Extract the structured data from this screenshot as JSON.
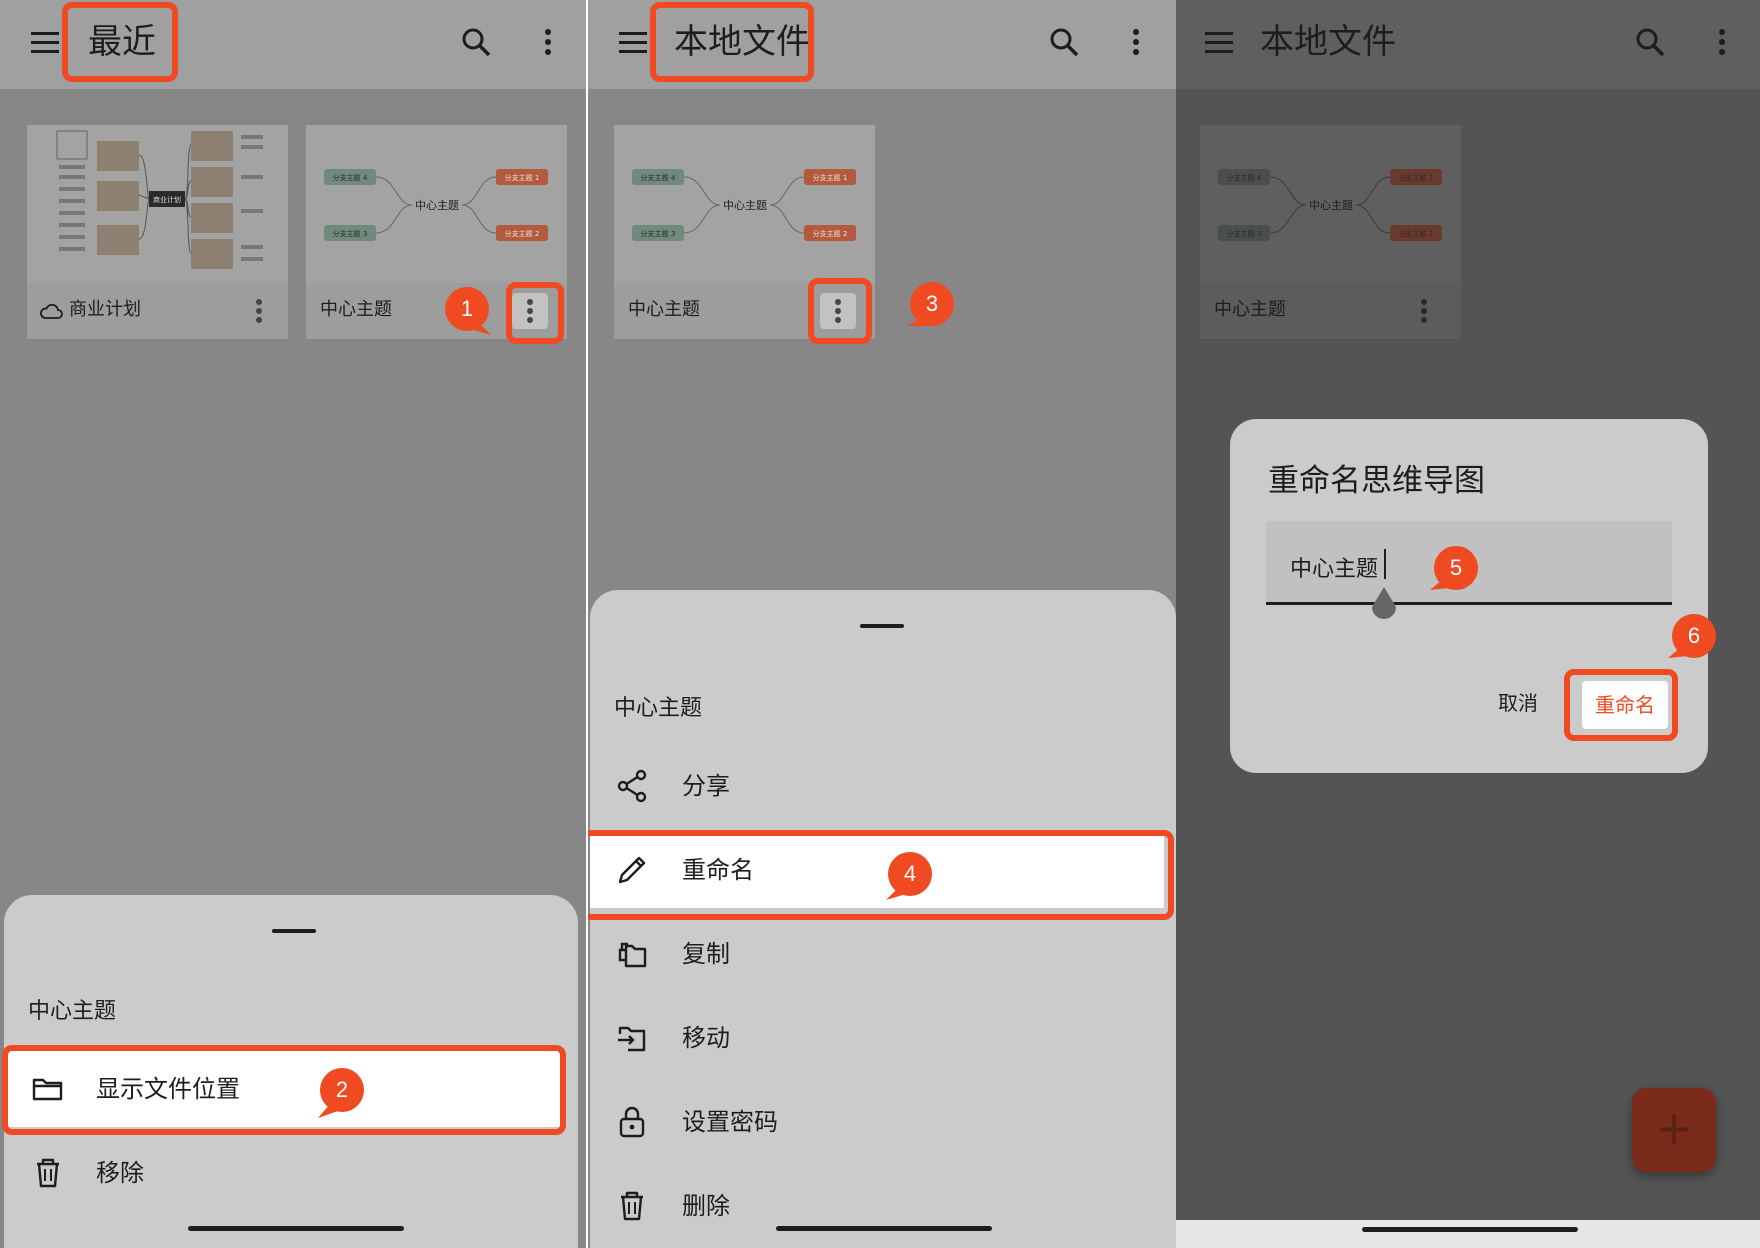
{
  "panel1": {
    "title": "最近",
    "card1_name": "商业计划",
    "card2_name": "中心主题",
    "card1_thumb_center": "商业计划",
    "sheet_title": "中心主题",
    "items": [
      {
        "label": "显示文件位置",
        "icon": "folder-icon"
      },
      {
        "label": "移除",
        "icon": "trash-icon"
      }
    ]
  },
  "panel2": {
    "title": "本地文件",
    "card_name": "中心主题",
    "sheet_title": "中心主题",
    "items": [
      {
        "label": "分享",
        "icon": "share-icon"
      },
      {
        "label": "重命名",
        "icon": "pencil-icon"
      },
      {
        "label": "复制",
        "icon": "copy-icon"
      },
      {
        "label": "移动",
        "icon": "move-icon"
      },
      {
        "label": "设置密码",
        "icon": "lock-icon"
      },
      {
        "label": "删除",
        "icon": "trash-icon"
      }
    ]
  },
  "panel3": {
    "title": "本地文件",
    "card_name": "中心主题",
    "dialog": {
      "title": "重命名思维导图",
      "input_value": "中心主题",
      "cancel_label": "取消",
      "confirm_label": "重命名"
    },
    "fab_label": "+"
  },
  "mindmap": {
    "center": "中心主题",
    "branch1": "分支主题 1",
    "branch2": "分支主题 2",
    "branch3": "分支主题 3",
    "branch4": "分支主题 4"
  },
  "steps": [
    "1",
    "2",
    "3",
    "4",
    "5",
    "6"
  ],
  "colors": {
    "accent": "#f04a23",
    "dim_bg_light": "#8a8a8a",
    "dim_bg_dark": "#545454",
    "sheet_bg": "#cbcbcb"
  }
}
